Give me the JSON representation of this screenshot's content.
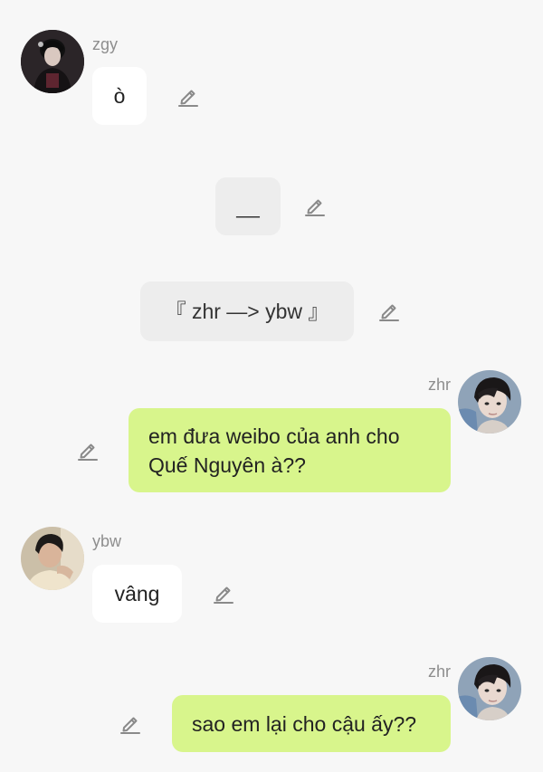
{
  "messages": [
    {
      "sender": "zgy",
      "text": "ò",
      "side": "left"
    },
    {
      "text": "__",
      "side": "center"
    },
    {
      "text": "『 zhr —> ybw 』",
      "side": "center"
    },
    {
      "sender": "zhr",
      "text": "em đưa weibo của anh cho Quế Nguyên à??",
      "side": "right"
    },
    {
      "sender": "ybw",
      "text": "vâng",
      "side": "left"
    },
    {
      "sender": "zhr",
      "text": "sao em lại cho cậu ấy??",
      "side": "right"
    }
  ],
  "colors": {
    "background": "#f7f7f7",
    "incoming_bubble": "#ffffff",
    "narration_bubble": "#ededed",
    "outgoing_bubble": "#d8f58c",
    "sender_name": "#8e8e8e",
    "edit_icon": "#8a8a8a"
  },
  "icons": {
    "edit": "pencil-edit-icon",
    "avatar": "avatar-photo"
  }
}
